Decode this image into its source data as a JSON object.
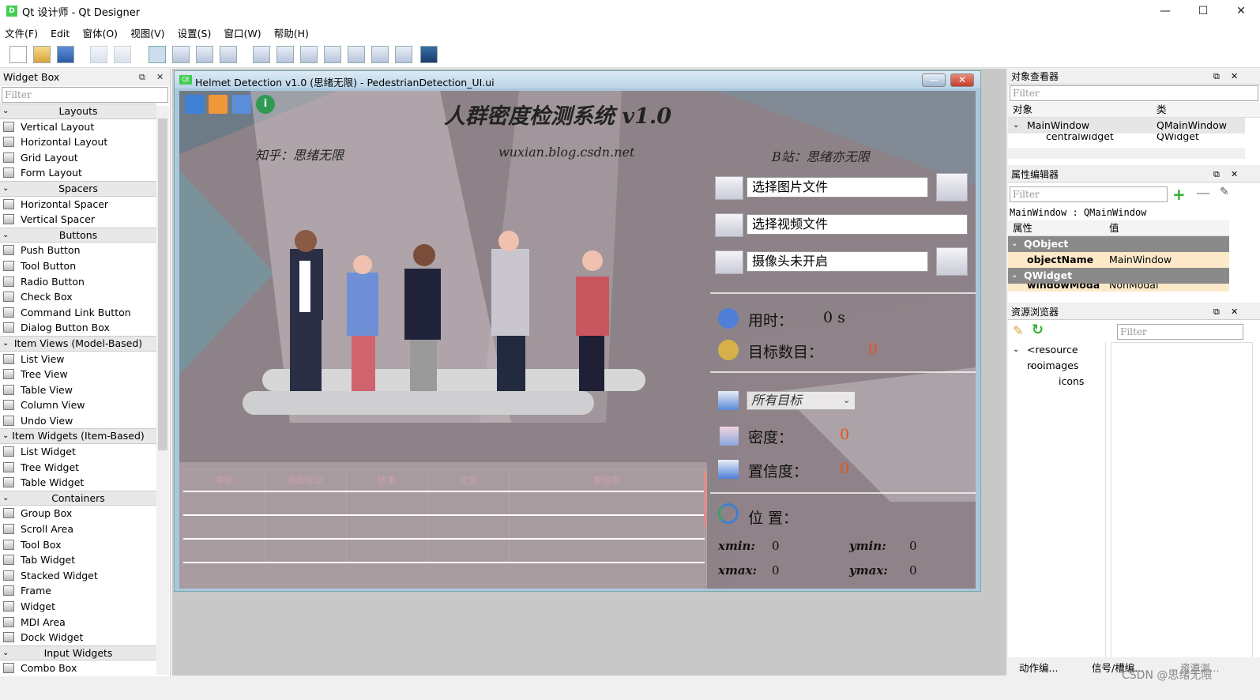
{
  "window": {
    "title": "Qt 设计师 - Qt Designer",
    "minimize": "—",
    "maximize": "☐",
    "close": "✕"
  },
  "menu": [
    "文件(F)",
    "Edit",
    "窗体(O)",
    "视图(V)",
    "设置(S)",
    "窗口(W)",
    "帮助(H)"
  ],
  "widget_box": {
    "title": "Widget Box",
    "filter_placeholder": "Filter",
    "groups": [
      {
        "name": "Layouts",
        "items": [
          "Vertical Layout",
          "Horizontal Layout",
          "Grid Layout",
          "Form Layout"
        ]
      },
      {
        "name": "Spacers",
        "items": [
          "Horizontal Spacer",
          "Vertical Spacer"
        ]
      },
      {
        "name": "Buttons",
        "items": [
          "Push Button",
          "Tool Button",
          "Radio Button",
          "Check Box",
          "Command Link Button",
          "Dialog Button Box"
        ]
      },
      {
        "name": "Item Views (Model-Based)",
        "items": [
          "List View",
          "Tree View",
          "Table View",
          "Column View",
          "Undo View"
        ]
      },
      {
        "name": "Item Widgets (Item-Based)",
        "items": [
          "List Widget",
          "Tree Widget",
          "Table Widget"
        ]
      },
      {
        "name": "Containers",
        "items": [
          "Group Box",
          "Scroll Area",
          "Tool Box",
          "Tab Widget",
          "Stacked Widget",
          "Frame",
          "Widget",
          "MDI Area",
          "Dock Widget"
        ]
      },
      {
        "name": "Input Widgets",
        "items": [
          "Combo Box"
        ]
      }
    ]
  },
  "form": {
    "window_title": "Helmet Detection v1.0  (思绪无限)   - PedestrianDetection_UI.ui",
    "app_title": "人群密度检测系统  v1.0",
    "zhihu": "知乎：思绪无限",
    "blog": "wuxian.blog.csdn.net",
    "bilibili": "B站：思绪亦无限",
    "select_image": "选择图片文件",
    "select_video": "选择视频文件",
    "camera": "摄像头未开启",
    "time_label": "用时：",
    "time_value": "0 s",
    "count_label": "目标数目：",
    "count_value": "0",
    "target_select": "所有目标",
    "density_label": "密度：",
    "density_value": "0",
    "confidence_label": "置信度：",
    "confidence_value": "0",
    "position_label": "位 置：",
    "xmin_label": "xmin:",
    "xmin_value": "0",
    "ymin_label": "ymin:",
    "ymin_value": "0",
    "xmax_label": "xmax:",
    "xmax_value": "0",
    "ymax_label": "ymax:",
    "ymax_value": "0",
    "table_headers": [
      "序号",
      "画面标识",
      "结果",
      "位置",
      "置信度"
    ]
  },
  "object_inspector": {
    "title": "对象查看器",
    "filter_placeholder": "Filter",
    "col_object": "对象",
    "col_class": "类",
    "rows": [
      {
        "object": "MainWindow",
        "class": "QMainWindow"
      },
      {
        "object": "centralwidget",
        "class": "QWidget"
      }
    ]
  },
  "property_editor": {
    "title": "属性编辑器",
    "filter_placeholder": "Filter",
    "context": "MainWindow : QMainWindow",
    "col_prop": "属性",
    "col_value": "值",
    "rows": [
      {
        "prop": "QObject",
        "value": "",
        "group": true
      },
      {
        "prop": "objectName",
        "value": "MainWindow",
        "group": false
      },
      {
        "prop": "QWidget",
        "value": "",
        "group": true
      },
      {
        "prop": "windowModa",
        "value": "NonModal",
        "group": false
      }
    ]
  },
  "resource_browser": {
    "title": "资源浏览器",
    "filter_placeholder": "Filter",
    "tree": [
      "<resource roo...",
      "images",
      "icons"
    ]
  },
  "bottom_tabs": [
    "动作编...",
    "信号/槽编...",
    "资源浏..."
  ],
  "watermark": "CSDN @思绪无限",
  "colors": {
    "accent_red": "#e9521c",
    "group_row": "#8a8a8a",
    "selection": "#fbe9c8"
  }
}
